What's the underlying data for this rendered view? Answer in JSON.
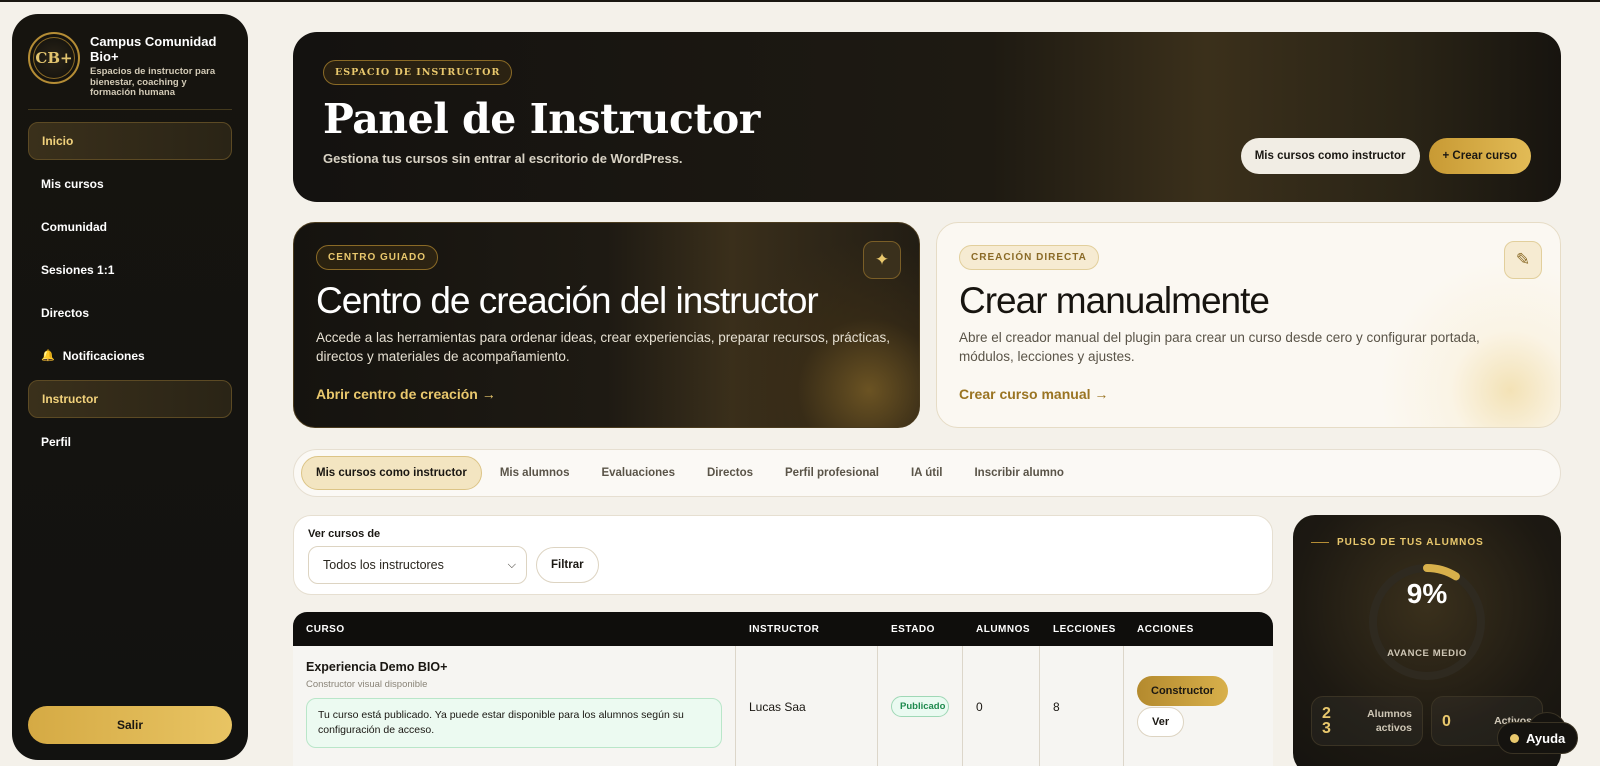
{
  "brand": {
    "logo_text": "CB+",
    "title": "Campus Comunidad Bio+",
    "subtitle": "Espacios de instructor para bienestar, coaching y formación humana"
  },
  "nav": {
    "items": [
      {
        "label": "Inicio",
        "active": true
      },
      {
        "label": "Mis cursos",
        "active": false
      },
      {
        "label": "Comunidad",
        "active": false
      },
      {
        "label": "Sesiones 1:1",
        "active": false
      },
      {
        "label": "Directos",
        "active": false
      },
      {
        "label": "Notificaciones",
        "active": false,
        "icon": "bell-icon"
      },
      {
        "label": "Instructor",
        "active": true
      },
      {
        "label": "Perfil",
        "active": false
      }
    ],
    "logout_label": "Salir"
  },
  "hero": {
    "pill": "ESPACIO DE INSTRUCTOR",
    "title": "Panel de Instructor",
    "subtitle": "Gestiona tus cursos sin entrar al escritorio de WordPress.",
    "btn_courses": "Mis cursos como instructor",
    "btn_create": "+ Crear curso"
  },
  "card_guided": {
    "pill": "CENTRO GUIADO",
    "title": "Centro de creación del instructor",
    "text": "Accede a las herramientas para ordenar ideas, crear experiencias, preparar recursos, prácticas, directos y materiales de acompañamiento.",
    "link": "Abrir centro de creación →",
    "icon": "sparkle-icon"
  },
  "card_manual": {
    "pill": "CREACIÓN DIRECTA",
    "title": "Crear manualmente",
    "text": "Abre el creador manual del plugin para crear un curso desde cero y configurar portada, módulos, lecciones y ajustes.",
    "link": "Crear curso manual →",
    "icon": "pencil-icon"
  },
  "tabs": [
    {
      "label": "Mis cursos como instructor",
      "active": true
    },
    {
      "label": "Mis alumnos",
      "active": false
    },
    {
      "label": "Evaluaciones",
      "active": false
    },
    {
      "label": "Directos",
      "active": false
    },
    {
      "label": "Perfil profesional",
      "active": false
    },
    {
      "label": "IA útil",
      "active": false
    },
    {
      "label": "Inscribir alumno",
      "active": false
    }
  ],
  "filter": {
    "label": "Ver cursos de",
    "selected": "Todos los instructores",
    "button": "Filtrar"
  },
  "table": {
    "headers": [
      "CURSO",
      "INSTRUCTOR",
      "ESTADO",
      "ALUMNOS",
      "LECCIONES",
      "ACCIONES"
    ],
    "rows": [
      {
        "course": "Experiencia Demo BIO+",
        "sub": "Constructor visual disponible",
        "notice": "Tu curso está publicado. Ya puede estar disponible para los alumnos según su configuración de acceso.",
        "instructor": "Lucas Saa",
        "status": "Publicado",
        "students": "0",
        "lessons": "8",
        "action_primary": "Constructor",
        "action_secondary": "Ver"
      }
    ]
  },
  "pulse": {
    "title": "PULSO DE TUS ALUMNOS",
    "value": "9%",
    "progress": 0.09,
    "label": "AVANCE MEDIO",
    "stats": [
      {
        "num": "23",
        "label": "Alumnos activos"
      },
      {
        "num": "0",
        "label": "Activos"
      }
    ]
  },
  "help": {
    "label": "Ayuda"
  },
  "colors": {
    "accent": "#e2bb56",
    "dark": "#15130f",
    "success": "#1e8a4e"
  }
}
